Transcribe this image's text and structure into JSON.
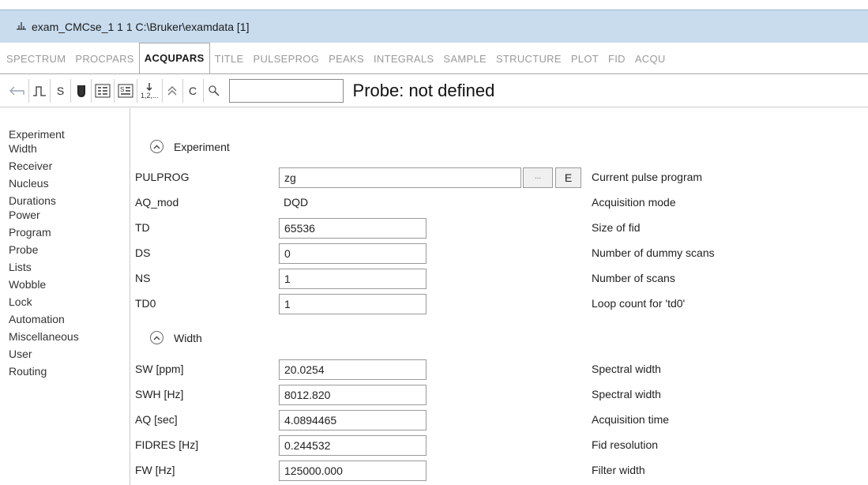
{
  "window": {
    "title": "exam_CMCse_1  1  1  C:\\Bruker\\examdata [1]",
    "title_icon": "spectrum-icon"
  },
  "tabs": [
    {
      "label": "SPECTRUM"
    },
    {
      "label": "PROCPARS"
    },
    {
      "label": "ACQUPARS",
      "active": true
    },
    {
      "label": "TITLE"
    },
    {
      "label": "PULSEPROG"
    },
    {
      "label": "PEAKS"
    },
    {
      "label": "INTEGRALS"
    },
    {
      "label": "SAMPLE"
    },
    {
      "label": "STRUCTURE"
    },
    {
      "label": "PLOT"
    },
    {
      "label": "FID"
    },
    {
      "label": "ACQU"
    }
  ],
  "toolbar": {
    "back_icon": "undo-arrow-icon",
    "pulse_icon": "pulse-icon",
    "s_label": "S",
    "probe_icon": "probe-icon",
    "list_icon": "parameter-list-icon",
    "status_icon": "status-parameter-icon",
    "sort_label": "1,2,...",
    "collapse_icon": "collapse-all-icon",
    "c_label": "C",
    "search_icon": "search-icon",
    "search_value": "",
    "probe_text": "Probe: not defined"
  },
  "sidebar": {
    "items": [
      {
        "label": "Experiment"
      },
      {
        "label": "Width"
      },
      {
        "label": "Receiver"
      },
      {
        "label": "Nucleus"
      },
      {
        "label": "Durations"
      },
      {
        "label": "Power"
      },
      {
        "label": "Program"
      },
      {
        "label": "Probe"
      },
      {
        "label": "Lists"
      },
      {
        "label": "Wobble"
      },
      {
        "label": "Lock"
      },
      {
        "label": "Automation"
      },
      {
        "label": "Miscellaneous"
      },
      {
        "label": "User"
      },
      {
        "label": "Routing"
      }
    ]
  },
  "sections": {
    "experiment": {
      "title": "Experiment",
      "params": {
        "pulprog": {
          "name": "PULPROG",
          "value": "zg",
          "desc": "Current pulse program",
          "browse_label": "...",
          "edit_label": "E"
        },
        "aq_mod": {
          "name": "AQ_mod",
          "value": "DQD",
          "desc": "Acquisition mode"
        },
        "td": {
          "name": "TD",
          "value": "65536",
          "desc": "Size of fid"
        },
        "ds": {
          "name": "DS",
          "value": "0",
          "desc": "Number of dummy scans"
        },
        "ns": {
          "name": "NS",
          "value": "1",
          "desc": "Number of scans"
        },
        "td0": {
          "name": "TD0",
          "value": "1",
          "desc": "Loop count for 'td0'"
        }
      }
    },
    "width": {
      "title": "Width",
      "params": {
        "sw": {
          "name": "SW [ppm]",
          "value": "20.0254",
          "desc": "Spectral width"
        },
        "swh": {
          "name": "SWH [Hz]",
          "value": "8012.820",
          "desc": "Spectral width"
        },
        "aq": {
          "name": "AQ [sec]",
          "value": "4.0894465",
          "desc": "Acquisition time"
        },
        "fidres": {
          "name": "FIDRES [Hz]",
          "value": "0.244532",
          "desc": "Fid resolution"
        },
        "fw": {
          "name": "FW [Hz]",
          "value": "125000.000",
          "desc": "Filter width"
        }
      }
    }
  }
}
